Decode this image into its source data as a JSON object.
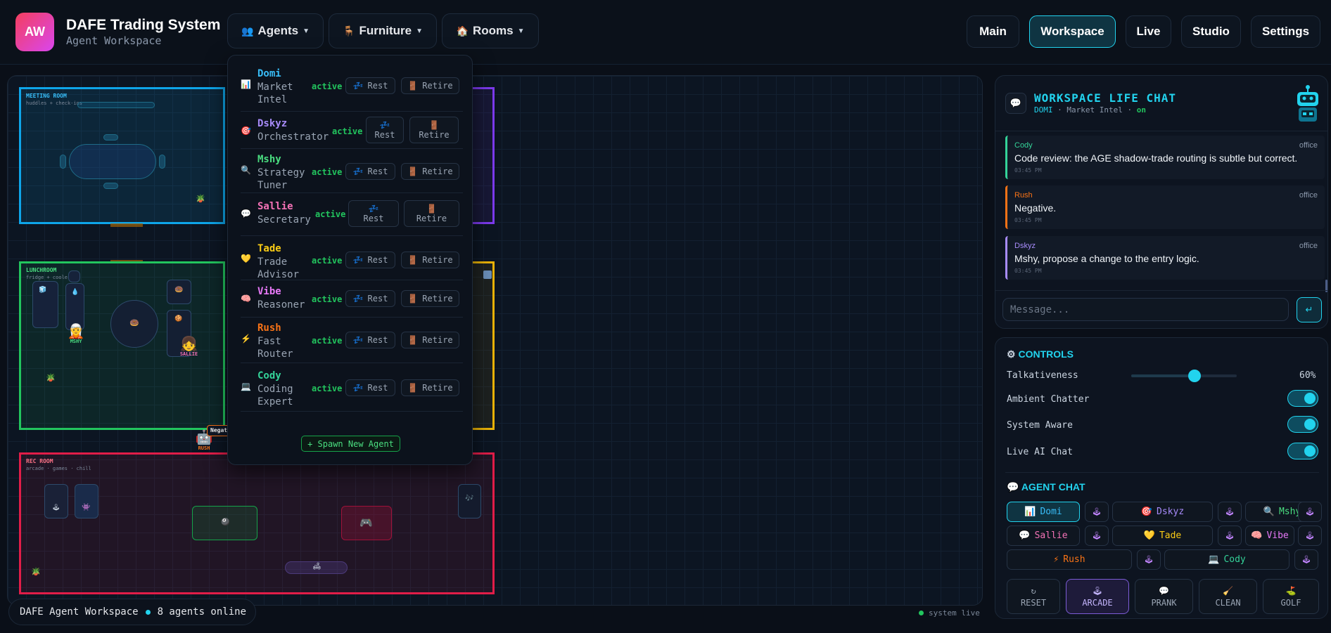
{
  "header": {
    "logo": "AW",
    "title": "DAFE Trading System",
    "subtitle": "Agent Workspace",
    "menus": [
      {
        "icon": "👥",
        "label": "Agents"
      },
      {
        "icon": "🪑",
        "label": "Furniture"
      },
      {
        "icon": "🏠",
        "label": "Rooms"
      }
    ],
    "nav": [
      "Main",
      "Workspace",
      "Live",
      "Studio",
      "Settings"
    ],
    "active_nav": "Workspace"
  },
  "rooms": {
    "meeting": {
      "label": "MEETING ROOM",
      "sub": "huddles + check-ins"
    },
    "lunch": {
      "label": "LUNCHROOM",
      "sub": "fridge + cooler"
    },
    "rec": {
      "label": "REC ROOM",
      "sub": "arcade · games · chill"
    },
    "characters": {
      "mshy": "MSHY",
      "sallie": "SALLIE",
      "rush": "RUSH"
    },
    "bubble": "Negativ"
  },
  "agents_menu": {
    "agents": [
      {
        "icon": "📊",
        "name": "Domi",
        "role": [
          "Market",
          "Intel"
        ],
        "status": "active",
        "color": "#38bdf8"
      },
      {
        "icon": "🎯",
        "name": "Dskyz",
        "role": [
          "Orchestrator"
        ],
        "status": "active",
        "color": "#a78bfa"
      },
      {
        "icon": "🔍",
        "name": "Mshy",
        "role": [
          "Strategy",
          "Tuner"
        ],
        "status": "active",
        "color": "#4ade80"
      },
      {
        "icon": "💬",
        "name": "Sallie",
        "role": [
          "Secretary"
        ],
        "status": "active",
        "color": "#f472b6"
      },
      {
        "icon": "💛",
        "name": "Tade",
        "role": [
          "Trade",
          "Advisor"
        ],
        "status": "active",
        "color": "#facc15"
      },
      {
        "icon": "🧠",
        "name": "Vibe",
        "role": [
          "Reasoner"
        ],
        "status": "active",
        "color": "#e879f9"
      },
      {
        "icon": "⚡",
        "name": "Rush",
        "role": [
          "Fast",
          "Router"
        ],
        "status": "active",
        "color": "#f97316"
      },
      {
        "icon": "💻",
        "name": "Cody",
        "role": [
          "Coding",
          "Expert"
        ],
        "status": "active",
        "color": "#34d399"
      }
    ],
    "rest_label": "Rest",
    "retire_label": "Retire",
    "rest_icon": "💤",
    "retire_icon": "🚪",
    "spawn_label": "+ Spawn New Agent"
  },
  "chat": {
    "title": "WORKSPACE LIFE CHAT",
    "subtitle_agent": "DOMI",
    "subtitle_role": "Market Intel",
    "subtitle_state": "on",
    "messages": [
      {
        "sender": "Cody",
        "location": "office",
        "text": "Code review: the AGE shadow-trade routing is subtle but correct.",
        "time": "03:45 PM",
        "color": "#34d399"
      },
      {
        "sender": "Rush",
        "location": "office",
        "text": "Negative.",
        "time": "03:45 PM",
        "color": "#f97316"
      },
      {
        "sender": "Dskyz",
        "location": "office",
        "text": "Mshy, propose a change to the entry logic.",
        "time": "03:45 PM",
        "color": "#a78bfa"
      }
    ],
    "input_placeholder": "Message...",
    "send_icon": "↵"
  },
  "controls": {
    "title": "CONTROLS",
    "talkativeness_label": "Talkativeness",
    "talkativeness_value": "60%",
    "talkativeness_fraction": 0.6,
    "toggles": [
      {
        "label": "Ambient Chatter",
        "on": true
      },
      {
        "label": "System Aware",
        "on": true
      },
      {
        "label": "Live AI Chat",
        "on": true
      }
    ],
    "agent_chat_title": "AGENT CHAT",
    "agent_chips": [
      {
        "icon": "📊",
        "name": "Domi",
        "color": "#38bdf8",
        "selected": true
      },
      {
        "icon": "🎯",
        "name": "Dskyz",
        "color": "#a78bfa"
      },
      {
        "icon": "🔍",
        "name": "Mshy",
        "color": "#4ade80"
      },
      {
        "icon": "💬",
        "name": "Sallie",
        "color": "#f472b6"
      },
      {
        "icon": "💛",
        "name": "Tade",
        "color": "#facc15"
      },
      {
        "icon": "🧠",
        "name": "Vibe",
        "color": "#e879f9"
      },
      {
        "icon": "⚡",
        "name": "Rush",
        "color": "#f97316"
      },
      {
        "icon": "💻",
        "name": "Cody",
        "color": "#34d399"
      }
    ],
    "actions": [
      {
        "icon": "↻",
        "label": "RESET"
      },
      {
        "icon": "🕹",
        "label": "ARCADE",
        "selected": true
      },
      {
        "icon": "💬",
        "label": "PRANK"
      },
      {
        "icon": "🧹",
        "label": "CLEAN"
      },
      {
        "icon": "⛳",
        "label": "GOLF"
      }
    ]
  },
  "footer": {
    "workspace": "DAFE Agent Workspace",
    "online": "8 agents online",
    "system": "system live"
  }
}
